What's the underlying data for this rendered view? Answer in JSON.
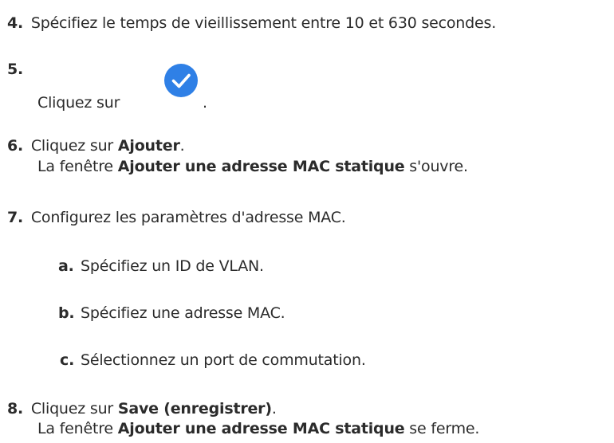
{
  "steps": {
    "s4": {
      "num": "4.",
      "text": "Spécifiez le temps de vieillissement entre 10 et 630 secondes."
    },
    "s5": {
      "num": "5.",
      "text_before": "Cliquez sur",
      "text_after": ".",
      "icon": "check-circle-icon",
      "icon_color": "#2f80e6"
    },
    "s6": {
      "num": "6.",
      "pre": "Cliquez sur ",
      "bold": "Ajouter",
      "post": ".",
      "result_pre": "La fenêtre ",
      "result_bold": "Ajouter une adresse MAC statique",
      "result_post": " s'ouvre."
    },
    "s7": {
      "num": "7.",
      "text": "Configurez les paramètres d'adresse MAC.",
      "substeps": [
        {
          "letter": "a.",
          "text": "Spécifiez un ID de VLAN."
        },
        {
          "letter": "b.",
          "text": "Spécifiez une adresse MAC."
        },
        {
          "letter": "c.",
          "text": "Sélectionnez un port de commutation."
        }
      ]
    },
    "s8": {
      "num": "8.",
      "pre": "Cliquez sur ",
      "bold": "Save (enregistrer)",
      "post": ".",
      "result_pre": "La fenêtre ",
      "result_bold": "Ajouter une adresse MAC statique",
      "result_post": " se ferme."
    }
  }
}
